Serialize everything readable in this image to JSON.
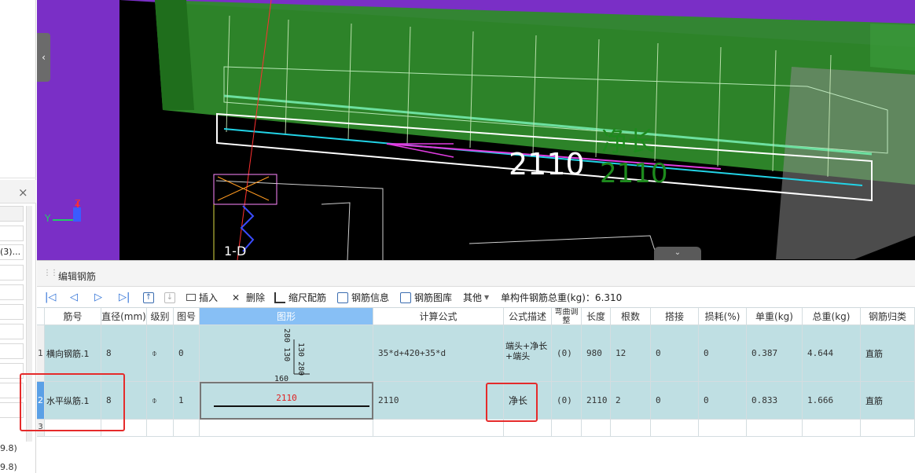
{
  "left_panel": {
    "close_glyph": "×",
    "truncated_item": "(3)...",
    "bottom_labels": [
      "9.8)",
      "9.8)"
    ]
  },
  "viewport": {
    "axis_y": "Y",
    "axis_z": "Z",
    "dim_value": "2110",
    "net_length_label": "净长",
    "net_length_value": "2110",
    "grid_label": "1-D",
    "collapse_glyph": "‹",
    "expand_glyph": "⌄"
  },
  "editor": {
    "title": "编辑钢筋",
    "toolbar": {
      "insert": "插入",
      "delete": "删除",
      "scale_rebar": "缩尺配筋",
      "rebar_info": "钢筋信息",
      "rebar_library": "钢筋图库",
      "other": "其他",
      "total_weight": "单构件钢筋总重(kg)：6.310"
    },
    "columns": [
      "筋号",
      "直径(mm)",
      "级别",
      "图号",
      "图形",
      "计算公式",
      "公式描述",
      "弯曲调整",
      "长度",
      "根数",
      "搭接",
      "损耗(%)",
      "单重(kg)",
      "总重(kg)",
      "钢筋归类"
    ],
    "rows": [
      {
        "index": "1",
        "bar_no": "横向钢筋.1",
        "diameter": "8",
        "grade": "⌽",
        "fig_no": "0",
        "shape": {
          "left_label": "280 130",
          "right_label": "130 280",
          "bottom_label": "160"
        },
        "formula": "35*d+420+35*d",
        "formula_desc": "端头+净长+端头",
        "bend_adj": "(0)",
        "length": "980",
        "count": "12",
        "lap": "0",
        "loss": "0",
        "unit_weight": "0.387",
        "total_weight": "4.644",
        "category": "直筋"
      },
      {
        "index": "2",
        "bar_no": "水平纵筋.1",
        "diameter": "8",
        "grade": "⌽",
        "fig_no": "1",
        "shape": {
          "value": "2110"
        },
        "formula": "2110",
        "formula_desc": "净长",
        "bend_adj": "(0)",
        "length": "2110",
        "count": "2",
        "lap": "0",
        "loss": "0",
        "unit_weight": "0.833",
        "total_weight": "1.666",
        "category": "直筋"
      },
      {
        "index": "3"
      }
    ]
  },
  "colors": {
    "viewport_purple": "#7a2fc6",
    "viewport_green": "#2f8a2b",
    "row_teal": "#bfdfe3",
    "selected_header": "#87bff5",
    "annotation_red": "#e52b2b"
  }
}
